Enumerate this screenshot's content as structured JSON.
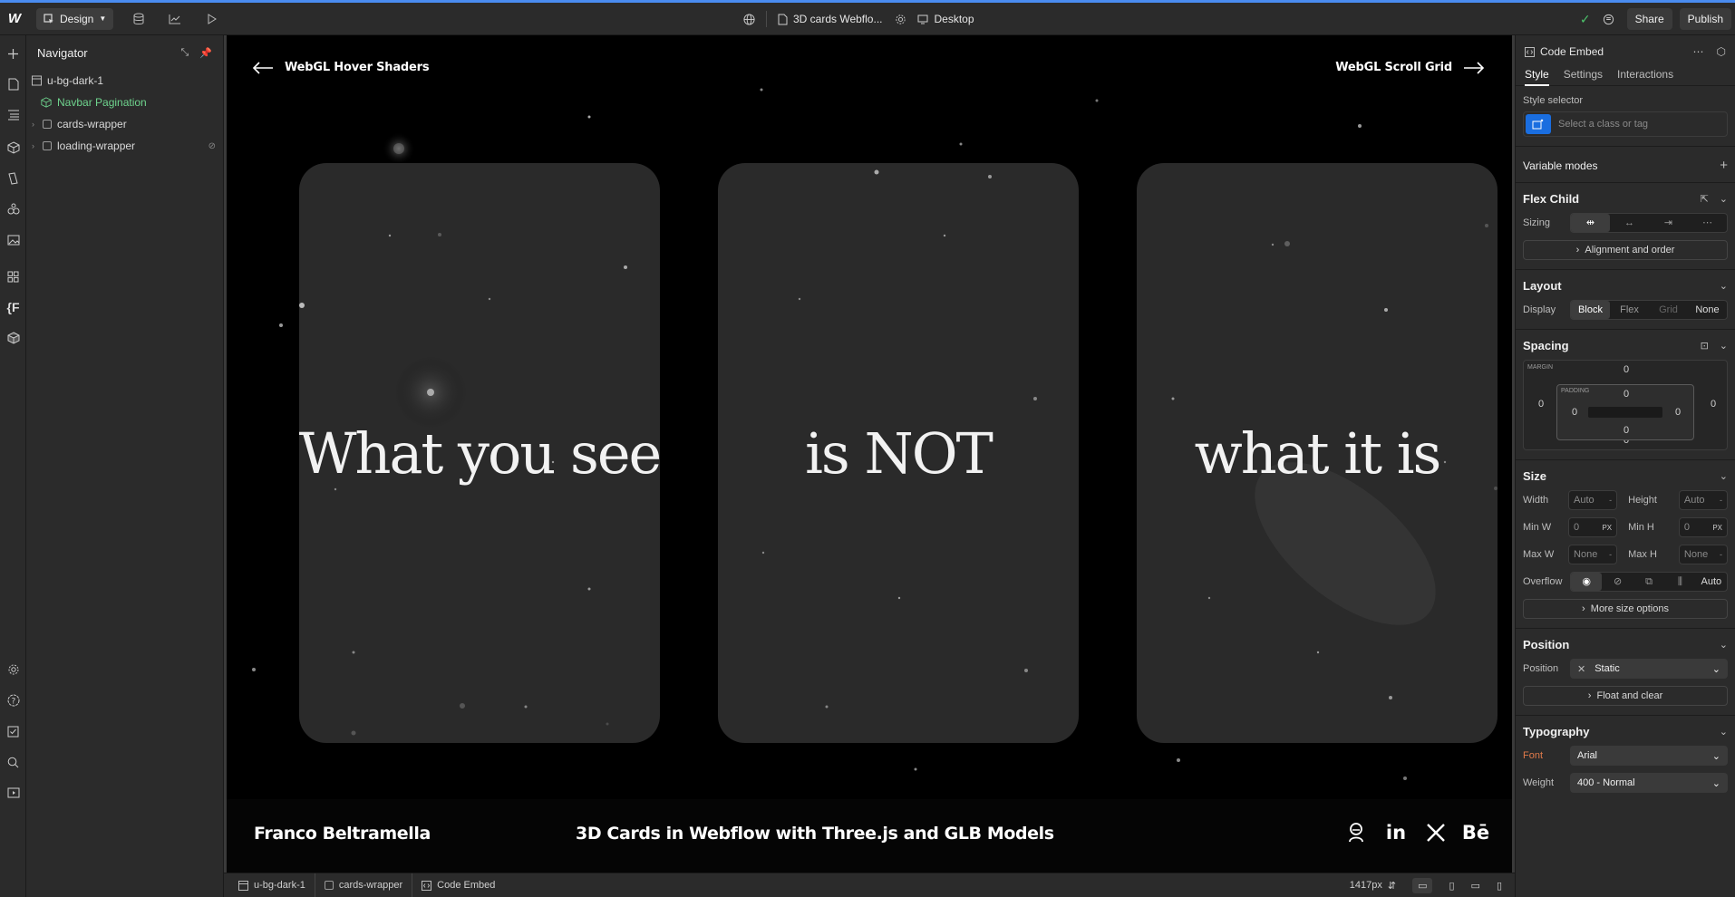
{
  "topbar": {
    "mode_label": "Design",
    "page_name": "3D cards Webflo...",
    "breakpoint_label": "Desktop",
    "share_label": "Share",
    "publish_label": "Publish"
  },
  "navigator": {
    "title": "Navigator",
    "items": [
      {
        "label": "u-bg-dark-1"
      },
      {
        "label": "Navbar Pagination"
      },
      {
        "label": "cards-wrapper"
      },
      {
        "label": "loading-wrapper"
      }
    ]
  },
  "canvas": {
    "nav_left": "WebGL Hover Shaders",
    "nav_right": "WebGL Scroll Grid",
    "cards": [
      {
        "text": "What you see"
      },
      {
        "text": "is NOT"
      },
      {
        "text": "what it is"
      }
    ],
    "footer_author": "Franco Beltramella",
    "footer_title": "3D Cards in Webflow with Three.js and GLB Models",
    "social": [
      "github-icon",
      "linkedin-icon",
      "x-icon",
      "behance-icon"
    ],
    "social_text": {
      "linkedin": "in",
      "behance": "Bē"
    }
  },
  "breadcrumbs": {
    "items": [
      "u-bg-dark-1",
      "cards-wrapper",
      "Code Embed"
    ],
    "width_readout": "1417px"
  },
  "panel": {
    "element_name": "Code Embed",
    "tabs": [
      "Style",
      "Settings",
      "Interactions"
    ],
    "style_selector_label": "Style selector",
    "style_selector_placeholder": "Select a class or tag",
    "variable_modes": "Variable modes",
    "flex_child": {
      "title": "Flex Child",
      "sizing_label": "Sizing",
      "alignment_button": "Alignment and order"
    },
    "layout": {
      "title": "Layout",
      "display_label": "Display",
      "options": [
        "Block",
        "Flex",
        "Grid",
        "None"
      ]
    },
    "spacing": {
      "title": "Spacing",
      "margin_label": "MARGIN",
      "padding_label": "PADDING",
      "margin": {
        "top": "0",
        "right": "0",
        "bottom": "0",
        "left": "0"
      },
      "padding": {
        "top": "0",
        "right": "0",
        "bottom": "0",
        "left": "0"
      }
    },
    "size": {
      "title": "Size",
      "width_label": "Width",
      "width_value": "Auto",
      "height_label": "Height",
      "height_value": "Auto",
      "minw_label": "Min W",
      "minw_value": "0",
      "minw_unit": "PX",
      "minh_label": "Min H",
      "minh_value": "0",
      "minh_unit": "PX",
      "maxw_label": "Max W",
      "maxw_value": "None",
      "maxh_label": "Max H",
      "maxh_value": "None",
      "overflow_label": "Overflow",
      "overflow_auto": "Auto",
      "more_button": "More size options"
    },
    "position": {
      "title": "Position",
      "label": "Position",
      "value": "Static",
      "float_button": "Float and clear"
    },
    "typography": {
      "title": "Typography",
      "font_label": "Font",
      "font_value": "Arial",
      "weight_label": "Weight",
      "weight_value": "400 - Normal"
    }
  },
  "colors": {
    "accent_blue": "#1a6ee0",
    "component_green": "#6fd48e",
    "font_label_orange": "#e07a4a"
  }
}
